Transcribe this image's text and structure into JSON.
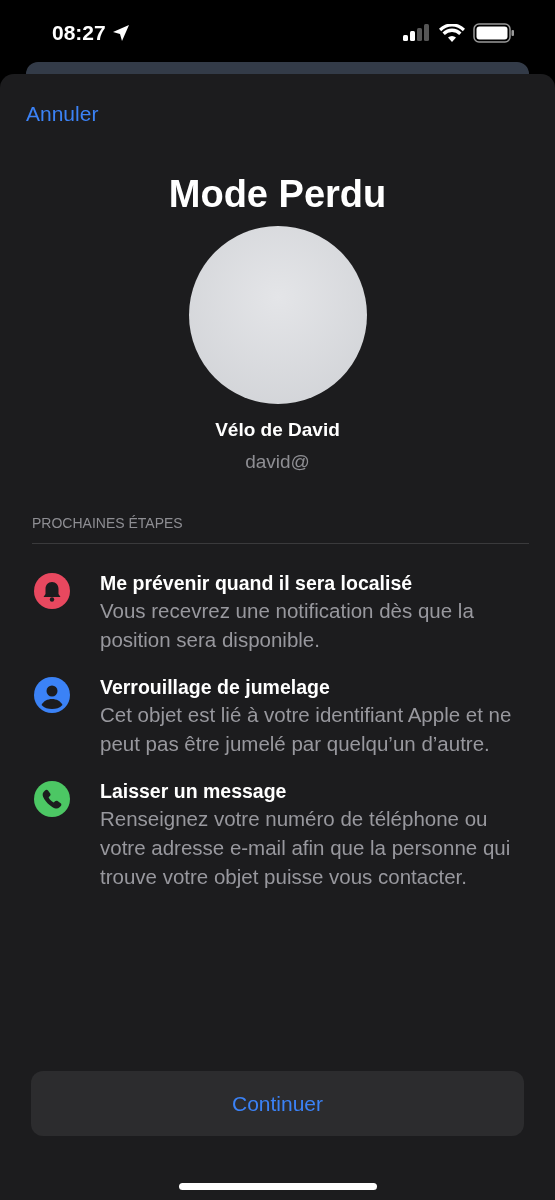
{
  "status_bar": {
    "time": "08:27"
  },
  "nav": {
    "cancel": "Annuler"
  },
  "title": "Mode Perdu",
  "device": {
    "name": "Vélo de David",
    "account": "david@"
  },
  "section_header": "PROCHAINES ÉTAPES",
  "steps": [
    {
      "kind": "bell",
      "color": "#e8485f",
      "title": "Me prévenir quand il sera localisé",
      "description": "Vous recevrez une notification dès que la position sera disponible."
    },
    {
      "kind": "person",
      "color": "#3b82f6",
      "title": "Verrouillage de jumelage",
      "description": "Cet objet est lié à votre identifiant Apple et ne peut pas être jumelé par quelqu’un d’autre."
    },
    {
      "kind": "phone",
      "color": "#4cc764",
      "title": "Laisser un message",
      "description": "Renseignez votre numéro de téléphone ou votre adresse e-mail afin que la personne qui trouve votre objet puisse vous contacter."
    }
  ],
  "continue_button": "Continuer"
}
